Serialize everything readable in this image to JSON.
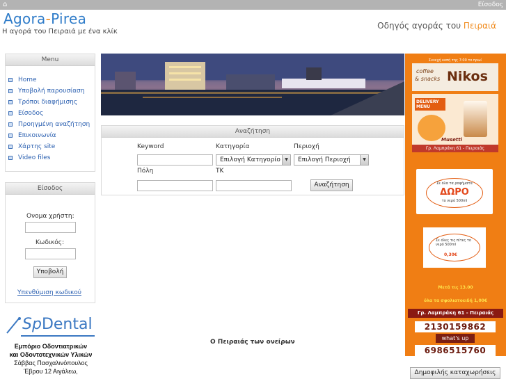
{
  "topbar": {
    "home_icon": "home-icon",
    "login_link": "Είσοδος"
  },
  "header": {
    "logo_part1": "Agora",
    "logo_dash": "-",
    "logo_part2": "Pirea",
    "tagline": "Η αγορά του Πειραιά με ένα κλίκ",
    "guide_prefix": "Οδηγός αγοράς του ",
    "guide_highlight": "Πειραιά"
  },
  "menu": {
    "title": "Menu",
    "items": [
      {
        "label": "Home"
      },
      {
        "label": "Υποβολή παρουσίαση"
      },
      {
        "label": "Τρόποι διαφήμισης"
      },
      {
        "label": "Είσοδος"
      },
      {
        "label": "Προηγμένη αναζήτηση"
      },
      {
        "label": "Επικοινωνία"
      },
      {
        "label": "Χάρτης site"
      },
      {
        "label": "Video files"
      }
    ]
  },
  "login": {
    "title": "Είσοδος",
    "username_label": "Ονομα χρήστη:",
    "password_label": "Κωδικός:",
    "submit": "Υποβολή",
    "reminder": "Υπενθύμιση κωδικού"
  },
  "search": {
    "title": "Αναζήτηση",
    "keyword_label": "Keyword",
    "category_label": "Κατηγορία",
    "area_label": "Περιοχή",
    "city_label": "Πόλη",
    "zip_label": "ΤΚ",
    "category_value": "Επιλογή Κατηγορίο",
    "area_value": "Επιλογή Περιοχή",
    "submit": "Αναζήτηση"
  },
  "dream_text": "Ο Πειραιάς των ονείρων",
  "spdental": {
    "logo_sp": "Sp",
    "logo_dental": "Dental",
    "line1": "Εμπόριο Οδοντιατρικών",
    "line2": "και Οδοντοτεχνικών Υλικών",
    "line3": "Σάββας Πασχαλινόπουλος",
    "line4": "Έβρου 12 Αιγάλεω,"
  },
  "ad": {
    "top_strip": "Συνεχή κοπή της 7:00 το πρωί",
    "brand_coffee": "coffee",
    "brand_snacks": "& snacks",
    "brand_name": "Nikos",
    "delivery": "DELIVERY MENU",
    "musetti": "Musetti",
    "address1": "Γρ. Λαμπράκη 61 - Πειραιάς",
    "promo1_top": "Σε όλα τα ροφήματα",
    "promo1_big": "ΔΩΡΟ",
    "promo1_bottom": "το νερό 500ml",
    "promo2_text": "Σε όλες τις πίτες το νερό 500ml",
    "promo2_price": "0,30€",
    "time_text": "Μετά τις 13.00",
    "offer_text": "όλα τα σφολιατοειδή 1,00€",
    "address2": "Γρ. Λαμπράκη 61 - Πειραιάς",
    "phone1": "2130159862",
    "whatsup": "what's up",
    "phone2": "6986515760"
  },
  "popular_button": "Δημοφιλής καταχωρήσεις",
  "colors": {
    "brand_blue": "#2f7cc9",
    "brand_orange": "#f08a1c",
    "ad_orange": "#f07e14",
    "link_blue": "#2a5fb0"
  }
}
